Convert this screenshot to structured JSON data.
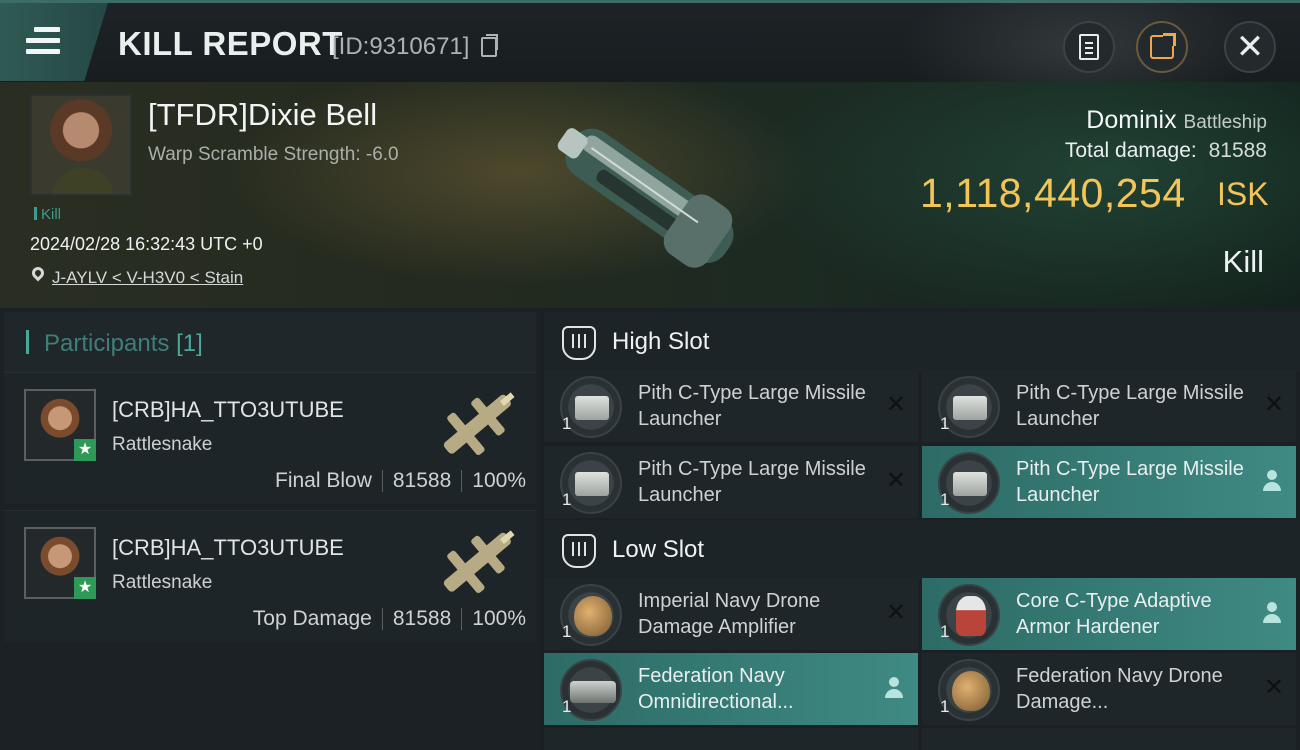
{
  "header": {
    "title": "KILL REPORT",
    "report_id": "[ID:9310671]"
  },
  "victim": {
    "name": "[TFDR]Dixie Bell",
    "warp_scramble": "Warp Scramble Strength: -6.0",
    "tag": "Kill",
    "timestamp": "2024/02/28 16:32:43 UTC +0",
    "location": "J-AYLV < V-H3V0 < Stain",
    "ship": "Dominix",
    "ship_class": "Battleship",
    "total_damage_label": "Total damage:",
    "total_damage": "81588",
    "isk_value": "1,118,440,254",
    "isk_unit": "ISK",
    "result": "Kill"
  },
  "participants": {
    "label": "Participants",
    "count": "[1]",
    "rows": [
      {
        "name": "[CRB]HA_TTO3UTUBE",
        "ship": "Rattlesnake",
        "role": "Final Blow",
        "damage": "81588",
        "percent": "100%"
      },
      {
        "name": "[CRB]HA_TTO3UTUBE",
        "ship": "Rattlesnake",
        "role": "Top Damage",
        "damage": "81588",
        "percent": "100%"
      }
    ]
  },
  "fitting": {
    "high_slot_label": "High Slot",
    "low_slot_label": "Low Slot",
    "high": [
      {
        "qty": "1",
        "name": "Pith C-Type Large Missile Launcher",
        "status": "destroyed",
        "icon": "missile-launcher-icon"
      },
      {
        "qty": "1",
        "name": "Pith C-Type Large Missile Launcher",
        "status": "destroyed",
        "icon": "missile-launcher-icon"
      },
      {
        "qty": "1",
        "name": "Pith C-Type Large Missile Launcher",
        "status": "destroyed",
        "icon": "missile-launcher-icon"
      },
      {
        "qty": "1",
        "name": "Pith C-Type Large Missile Launcher",
        "status": "dropped",
        "icon": "missile-launcher-icon"
      }
    ],
    "low": [
      {
        "qty": "1",
        "name": "Imperial Navy Drone Damage Amplifier",
        "status": "destroyed",
        "icon": "drone-damage-amplifier-icon"
      },
      {
        "qty": "1",
        "name": "Core C-Type Adaptive Armor Hardener",
        "status": "dropped",
        "icon": "armor-hardener-icon"
      },
      {
        "qty": "1",
        "name": "Federation Navy Omnidirectional...",
        "status": "dropped",
        "icon": "omnidirectional-tracking-icon"
      },
      {
        "qty": "1",
        "name": "Federation Navy Drone Damage...",
        "status": "destroyed",
        "icon": "drone-damage-amplifier-icon"
      }
    ]
  },
  "colors": {
    "accent_teal": "#3f8a83",
    "isk_gold": "#f2c45a",
    "share_orange": "#f0a64a"
  }
}
